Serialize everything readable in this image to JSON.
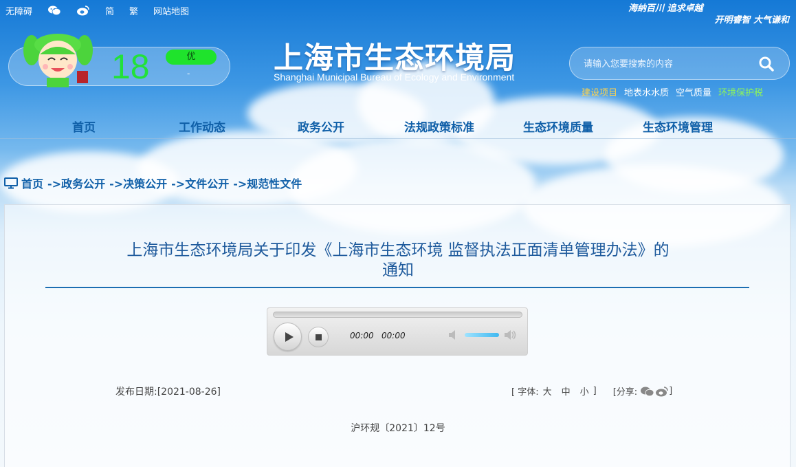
{
  "topbar": {
    "accessibility": "无障碍",
    "simplified": "简",
    "traditional": "繁",
    "sitemap": "网站地图",
    "icons": [
      "wechat-icon",
      "weibo-icon"
    ]
  },
  "slogan": {
    "line1": "海纳百川 追求卓越",
    "line2": "开明睿智 大气谦和"
  },
  "weather": {
    "aqi": "18",
    "level": "优",
    "detail": "-",
    "level_color": "#1fe32c",
    "aqi_color": "#22e13a"
  },
  "site": {
    "title": "上海市生态环境局",
    "subtitle": "Shanghai Municipal Bureau of Ecology and Environment"
  },
  "search": {
    "placeholder": "请输入您要搜索的内容"
  },
  "quick_links": [
    {
      "label": "建设项目",
      "color": "#ffd34d"
    },
    {
      "label": "地表水水质",
      "color": "#ffffff"
    },
    {
      "label": "空气质量",
      "color": "#ffffff"
    },
    {
      "label": "环境保护税",
      "color": "#8ef55a"
    }
  ],
  "nav": {
    "items": [
      "首页",
      "工作动态",
      "政务公开",
      "法规政策标准",
      "生态环境质量",
      "生态环境管理"
    ]
  },
  "breadcrumb": {
    "home": "首页",
    "items": [
      "->政务公开",
      "->决策公开",
      "->文件公开",
      "->规范性文件"
    ]
  },
  "article": {
    "title_line1": "上海市生态环境局关于印发《上海市生态环境 监督执法正面清单管理办法》的",
    "title_line2": "通知",
    "pubdate_label": "发布日期:",
    "pubdate": "[2021-08-26]",
    "doc_number": "沪环规〔2021〕12号"
  },
  "player": {
    "current_time": "00:00",
    "duration": "00:00"
  },
  "font_control": {
    "open": "[ 字体:",
    "large": "大",
    "medium": "中",
    "small": "小",
    "close": "]",
    "share_label": "[分享:",
    "share_close": "]"
  }
}
